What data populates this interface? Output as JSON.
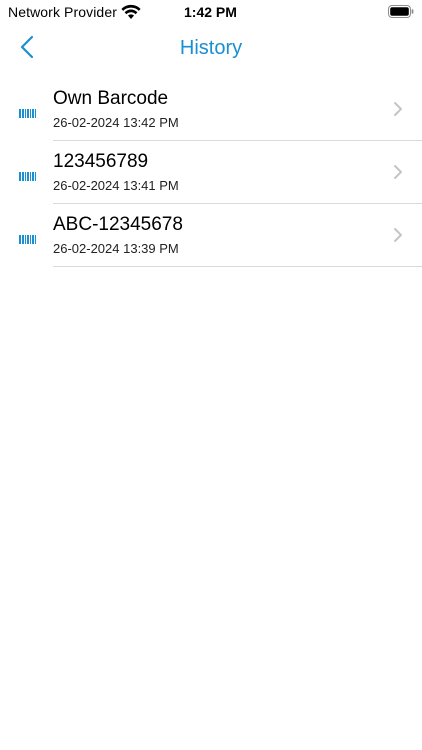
{
  "status_bar": {
    "carrier": "Network Provider",
    "time": "1:42 PM",
    "wifi_icon": "wifi-icon",
    "battery_icon": "battery-icon"
  },
  "nav": {
    "title": "History",
    "back_icon": "chevron-left-icon"
  },
  "colors": {
    "accent": "#1a8fd1",
    "divider": "#d9d9dc"
  },
  "history": {
    "items": [
      {
        "title": "Own Barcode",
        "date": "26-02-2024 13:42 PM",
        "icon": "barcode-icon"
      },
      {
        "title": "123456789",
        "date": "26-02-2024 13:41 PM",
        "icon": "barcode-icon"
      },
      {
        "title": "ABC-12345678",
        "date": "26-02-2024 13:39 PM",
        "icon": "barcode-icon"
      }
    ]
  }
}
